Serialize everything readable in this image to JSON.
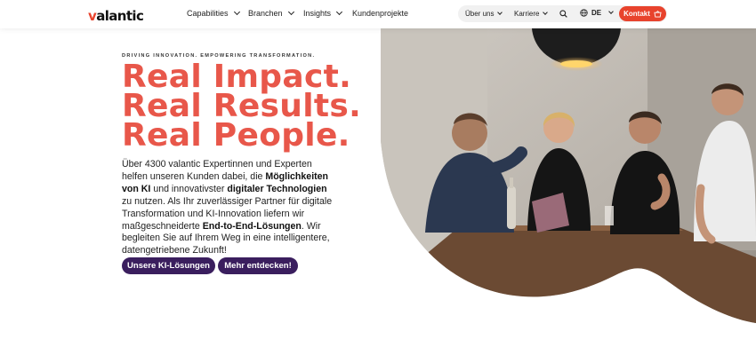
{
  "header": {
    "logo_prefix": "",
    "logo_v": "v",
    "logo_rest": "alantic",
    "nav": [
      "Capabilities",
      "Branchen",
      "Insights",
      "Kundenprojekte"
    ],
    "right": {
      "ueber_uns": "Über uns",
      "karriere": "Karriere",
      "lang": "DE",
      "kontakt": "Kontakt"
    }
  },
  "hero": {
    "eyebrow": "DRIVING INNOVATION. EMPOWERING TRANSFORMATION.",
    "headline": [
      "Real Impact.",
      "Real Results.",
      "Real People."
    ],
    "intro": {
      "p1": "Über 4300 valantic Expertinnen und Experten helfen unseren Kunden dabei, die ",
      "b1": "Möglichkeiten von KI",
      "p2": " und innovativster ",
      "b2": "digitaler Technologien",
      "p3": " zu nutzen. Als Ihr zuverlässiger Partner für digitale Transformation und KI-Innovation liefern wir maßgeschneiderte ",
      "b3": "End-to-End-Lösungen",
      "p4": ". Wir begleiten Sie auf Ihrem Weg in eine intelligentere, datengetriebene Zukunft!"
    },
    "buttons": [
      "Unsere KI-Lösungen",
      "Mehr entdecken!"
    ]
  },
  "icons": {
    "search": "search-icon",
    "globe": "globe-icon",
    "basket": "basket-icon",
    "chevron": "chevron-down-icon"
  },
  "colors": {
    "accent": "#e8432d",
    "headline": "#e8574a",
    "button": "#3a1e5e"
  }
}
